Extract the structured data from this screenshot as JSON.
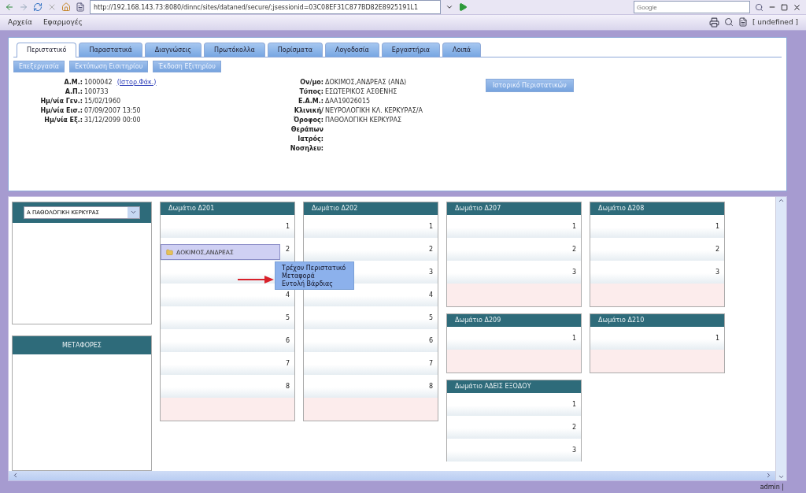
{
  "browser": {
    "url": "http://192.168.143.73:8080/dinnc/sites/dataned/secure/;jsessionid=03C08EF31C877BD82E8925191L1",
    "search_placeholder": "Google"
  },
  "menu": [
    "Αρχεία",
    "Εφαρμογές"
  ],
  "user_label": "[ undefined ]",
  "tabs": [
    {
      "label": "Περιστατικό",
      "selected": true
    },
    {
      "label": "Παραστατικά",
      "selected": false
    },
    {
      "label": "Διαγνώσεις",
      "selected": false
    },
    {
      "label": "Πρωτόκολλα",
      "selected": false
    },
    {
      "label": "Πορίσματα",
      "selected": false
    },
    {
      "label": "Λογοδοσία",
      "selected": false
    },
    {
      "label": "Εργαστήρια",
      "selected": false
    },
    {
      "label": "Λοιπά",
      "selected": false
    }
  ],
  "actions": [
    "Επεξεργασία",
    "Εκτύπωση Εισιτηρίου",
    "Έκδοση Εξιτηρίου"
  ],
  "history_button": "Ιστορικό Περιστατικών",
  "fields_left": [
    {
      "label": "Α.Μ.:",
      "value": "1000042",
      "link": "(Ιστορ.Φάκ.)"
    },
    {
      "label": "Α.Π.:",
      "value": "100733"
    },
    {
      "label": "Ημ/νία Γεν.:",
      "value": "15/02/1960"
    },
    {
      "label": "Ημ/νία Εισ.:",
      "value": "07/09/2007 13:50"
    },
    {
      "label": "Ημ/νία Εξ.:",
      "value": "31/12/2099 00:00"
    }
  ],
  "fields_right": [
    {
      "label": "Ον/μο:",
      "value": "ΔΟΚΙΜΟΣ,ΑΝΔΡΕΑΣ (ΑΝΔ)"
    },
    {
      "label": "Τύπος:",
      "value": "ΕΣΩΤΕΡΙΚΟΣ ΑΣΘΕΝΗΣ"
    },
    {
      "label": "Ε.Α.Μ.:",
      "value": "ΔΑΑ19026015"
    },
    {
      "label": "Κλινική/",
      "value": "ΝΕΥΡΟΛΟΓΙΚΗ ΚΛ. ΚΕΡΚΥΡΑΣ/Α"
    },
    {
      "label": "Όροφος:",
      "value": "ΠΑΘΟΛΟΓΙΚΗ ΚΕΡΚΥΡΑΣ"
    },
    {
      "label": "Θεράπων"
    },
    {
      "label": "Ιατρός:"
    },
    {
      "label": "Νοσηλευ:"
    }
  ],
  "ward_select": "Α ΠΑΘΟΛΟΓΙΚΗ ΚΕΡΚΥΡΑΣ",
  "transfers_title": "ΜΕΤΑΦΟΡΕΣ",
  "room_columns": [
    [
      {
        "title": "Δωμάτιο Δ201",
        "beds": [
          {
            "kind": "bed",
            "number": "1"
          },
          {
            "kind": "bed",
            "number": "2",
            "patient": "ΔΟΚΙΜΟΣ,ΑΝΔΡΕΑΣ"
          },
          {
            "kind": "covered"
          },
          {
            "kind": "bed",
            "number": "4"
          },
          {
            "kind": "bed",
            "number": "5"
          },
          {
            "kind": "bed",
            "number": "6"
          },
          {
            "kind": "bed",
            "number": "7"
          },
          {
            "kind": "bed",
            "number": "8"
          }
        ]
      }
    ],
    [
      {
        "title": "Δωμάτιο Δ202",
        "beds": [
          {
            "number": "1"
          },
          {
            "number": "2"
          },
          {
            "number": "3"
          },
          {
            "number": "4"
          },
          {
            "number": "5"
          },
          {
            "number": "6"
          },
          {
            "number": "7"
          },
          {
            "number": "8"
          }
        ]
      }
    ],
    [
      {
        "title": "Δωμάτιο Δ207",
        "beds": [
          {
            "number": "1"
          },
          {
            "number": "2"
          },
          {
            "number": "3"
          }
        ]
      },
      {
        "title": "Δωμάτιο Δ209",
        "beds": [
          {
            "number": "1"
          }
        ]
      },
      {
        "title": "Δωμάτιο ΑΔΕΙΣ ΕΞΟΔΟΥ",
        "beds": [
          {
            "number": "1"
          },
          {
            "number": "2"
          },
          {
            "number": "3"
          }
        ],
        "cut": true
      }
    ],
    [
      {
        "title": "Δωμάτιο Δ208",
        "beds": [
          {
            "number": "1"
          },
          {
            "number": "2"
          },
          {
            "number": "3"
          }
        ]
      },
      {
        "title": "Δωμάτιο Δ210",
        "beds": [
          {
            "number": "1"
          }
        ]
      }
    ]
  ],
  "context_menu": [
    "Τρέχον Περιστατικό",
    "Μεταφορά",
    "Εντολή Βάρδιας"
  ],
  "status": "admin |"
}
